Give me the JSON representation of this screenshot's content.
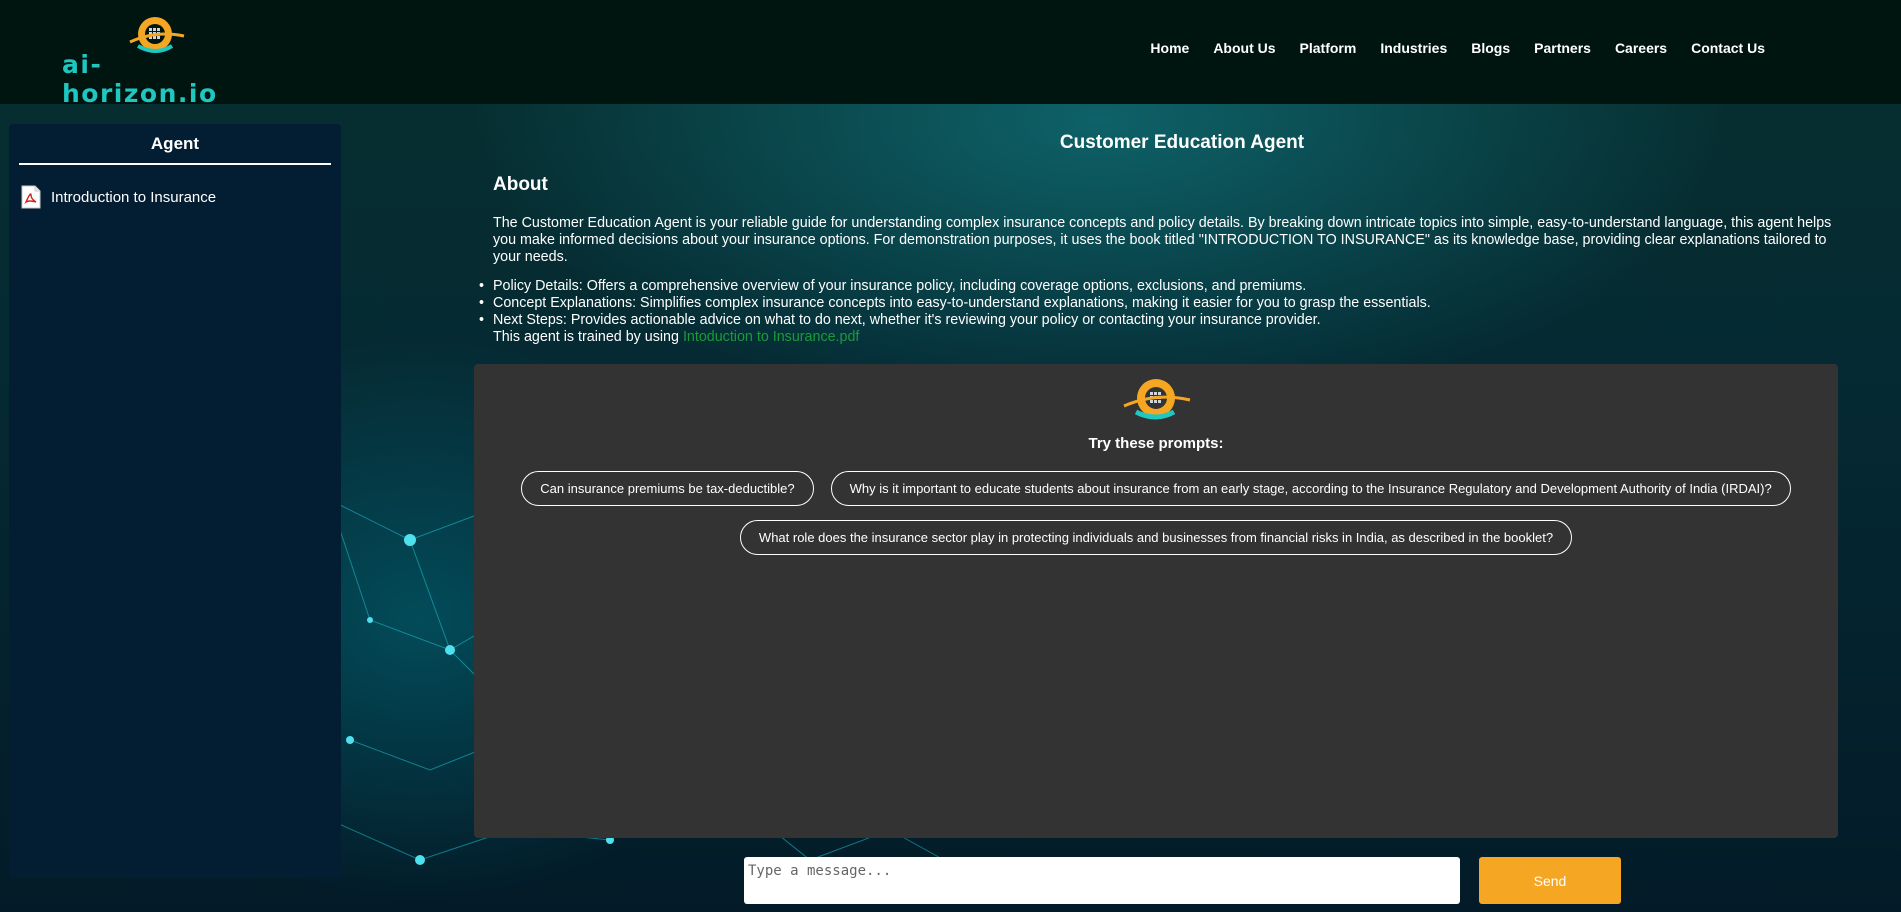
{
  "header": {
    "logo_text": "ai-horizon.io",
    "nav": [
      "Home",
      "About Us",
      "Platform",
      "Industries",
      "Blogs",
      "Partners",
      "Careers",
      "Contact Us"
    ]
  },
  "sidebar": {
    "title": "Agent",
    "items": [
      {
        "label": "Introduction to Insurance",
        "icon": "pdf-icon"
      }
    ]
  },
  "main": {
    "title": "Customer Education Agent",
    "about_heading": "About",
    "about_text": "The Customer Education Agent is your reliable guide for understanding complex insurance concepts and policy details. By breaking down intricate topics into simple, easy-to-understand language, this agent helps you make informed decisions about your insurance options. For demonstration purposes, it uses the book titled \"INTRODUCTION TO INSURANCE\" as its knowledge base, providing clear explanations tailored to your needs.",
    "bullets": [
      "Policy Details: Offers a comprehensive overview of your insurance policy, including coverage options, exclusions, and premiums.",
      "Concept Explanations: Simplifies complex insurance concepts into easy-to-understand explanations, making it easier for you to grasp the essentials.",
      "Next Steps: Provides actionable advice on what to do next, whether it's reviewing your policy or contacting your insurance provider."
    ],
    "trained_prefix": "This agent is trained by using ",
    "trained_link": "Intoduction to Insurance.pdf"
  },
  "chat": {
    "prompts_title": "Try these prompts:",
    "prompts": [
      "Can insurance premiums be tax-deductible?",
      "Why is it important to educate students about insurance from an early stage, according to the Insurance Regulatory and Development Authority of India (IRDAI)?",
      "What role does the insurance sector play in protecting individuals and businesses from financial risks in India, as described in the booklet?"
    ],
    "input_placeholder": "Type a message...",
    "send_label": "Send"
  },
  "colors": {
    "accent": "#f5a623",
    "brand_teal": "#1fc7c0",
    "link_green": "#1a9b3a",
    "panel": "#333333",
    "sidebar": "#031d33"
  }
}
